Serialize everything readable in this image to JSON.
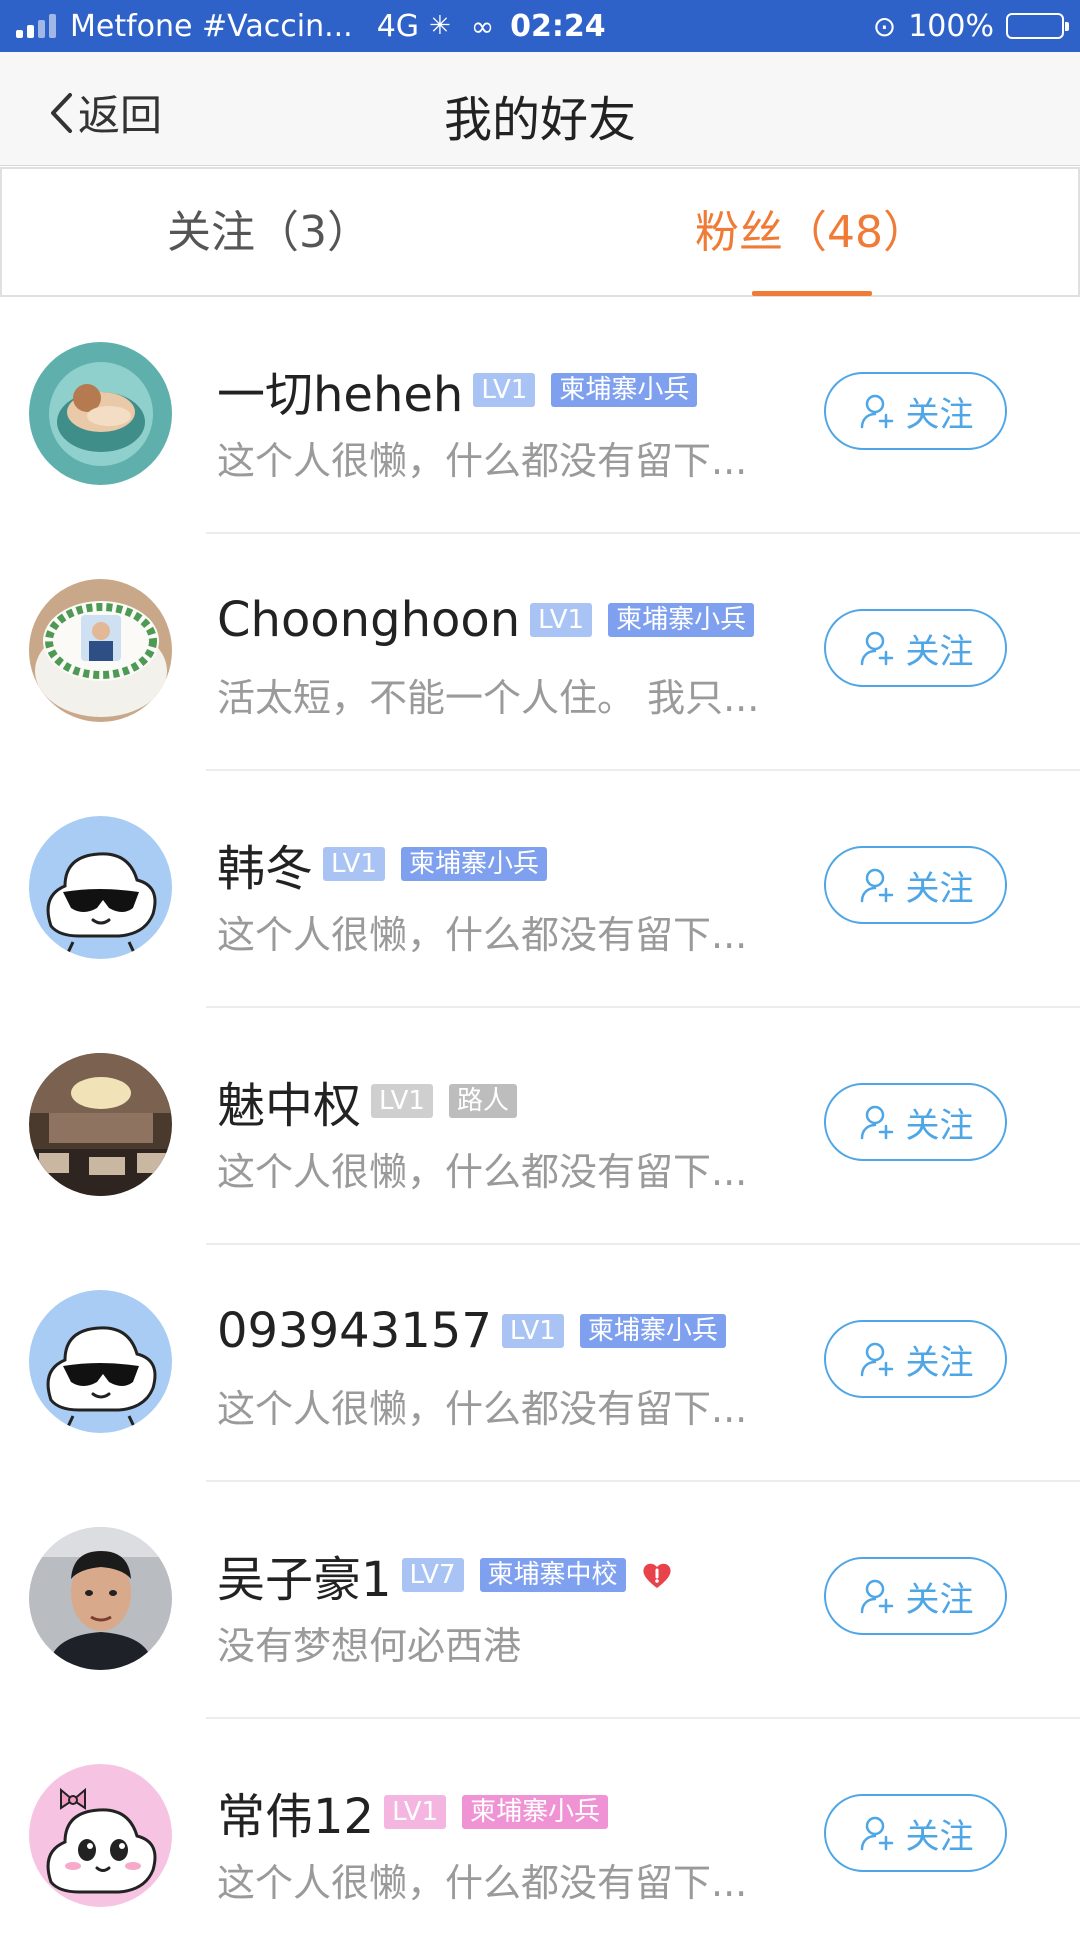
{
  "status_bar": {
    "carrier": "Metfone #Vaccin...",
    "network": "4G",
    "time": "02:24",
    "battery": "100%",
    "bar_color": "#2f62c9"
  },
  "nav": {
    "back_label": "返回",
    "title": "我的好友"
  },
  "tabs": [
    {
      "label": "关注（3）",
      "active": false
    },
    {
      "label": "粉丝（48）",
      "active": true
    }
  ],
  "colors": {
    "accent": "#f07b37",
    "follow_blue": "#4ea6e6",
    "level_blue": "#a9c4f4",
    "rank_blue": "#7ea0ef",
    "rank_gray": "#bdbdbd",
    "rank_pink": "#f093d4",
    "level_pink": "#f4b6e0"
  },
  "follow_label": "关注",
  "fans": [
    {
      "name": "一切heheh",
      "level": "LV1",
      "rank": "柬埔寨小兵",
      "rank_style": "blue",
      "bio": "这个人很懒，什么都没有留下...",
      "avatar": "baby-photo"
    },
    {
      "name": "Choonghoon",
      "level": "LV1",
      "rank": "柬埔寨小兵",
      "rank_style": "blue",
      "bio": "活太短，不能一个人住。 我只...",
      "avatar": "cake-photo"
    },
    {
      "name": "韩冬",
      "level": "LV1",
      "rank": "柬埔寨小兵",
      "rank_style": "blue",
      "bio": "这个人很懒，什么都没有留下...",
      "avatar": "cloud-sunglasses"
    },
    {
      "name": "魅中权",
      "level": "LV1",
      "rank": "路人",
      "rank_style": "gray",
      "bio": "这个人很懒，什么都没有留下...",
      "avatar": "restaurant-photo"
    },
    {
      "name": "093943157",
      "level": "LV1",
      "rank": "柬埔寨小兵",
      "rank_style": "blue",
      "bio": "这个人很懒，什么都没有留下...",
      "avatar": "cloud-sunglasses"
    },
    {
      "name": "吴子豪1",
      "level": "LV7",
      "rank": "柬埔寨中校",
      "rank_style": "blue",
      "bio": "没有梦想何必西港",
      "avatar": "man-photo",
      "heart": true
    },
    {
      "name": "常伟12",
      "level": "LV1",
      "rank": "柬埔寨小兵",
      "rank_style": "pink",
      "bio": "这个人很懒，什么都没有留下...",
      "avatar": "cloud-pink-bow"
    }
  ]
}
